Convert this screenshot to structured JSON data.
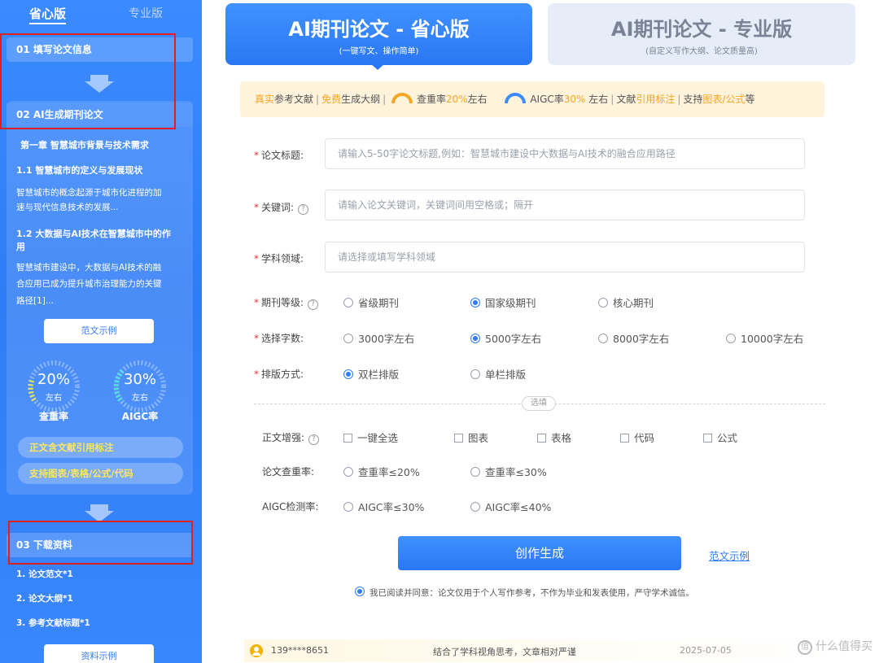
{
  "sidebar": {
    "tabs": [
      "省心版",
      "专业版"
    ],
    "step1": "01 填写论文信息",
    "step2": "02 AI生成期刊论文",
    "chapter": "第一章 智慧城市背景与技术需求",
    "sec1_title": "1.1 智慧城市的定义与发展现状",
    "sec1_body_1": "智慧城市的概念起源于城市化进程的加",
    "sec1_body_2": "速与现代信息技术的发展...",
    "sec2_title_1": "1.2 大数据与AI技术在智慧城市中的作",
    "sec2_title_2": "用",
    "sec2_body_1": "智慧城市建设中，大数据与AI技术的融",
    "sec2_body_2": "合应用已成为提升城市治理能力的关键",
    "sec2_body_3": "路径[1]...",
    "sample_btn": "范文示例",
    "gauge1_value": "20%",
    "gauge1_sub": "左右",
    "gauge1_label": "查重率",
    "gauge2_value": "30%",
    "gauge2_sub": "左右",
    "gauge2_label": "AIGC率",
    "pill1": "正文含文献引用标注",
    "pill2": "支持图表/表格/公式/代码",
    "step3": "03 下载资料",
    "downloads": [
      "1. 论文范文*1",
      "2. 论文大纲*1",
      "3. 参考文献标题*1"
    ],
    "download_sample_btn": "资料示例"
  },
  "modes": {
    "active_title": "AI期刊论文 - 省心版",
    "active_sub": "(一键写文、操作简单)",
    "inactive_title": "AI期刊论文 - 专业版",
    "inactive_sub": "(自定义写作大纲、论文质量高)"
  },
  "features": {
    "f1a": "真实",
    "f1b": "参考文献",
    "f2a": "免费",
    "f2b": "生成大纲",
    "f3a": "查重率",
    "f3b": "20%",
    "f3c": "左右",
    "f4a": "AIGC率",
    "f4b": "30%",
    "f4c": " 左右",
    "f5a": "文献",
    "f5b": "引用标注",
    "f6a": "支持",
    "f6b": "图表/公式",
    "f6c": "等",
    "sep": "|"
  },
  "form": {
    "title_label": "论文标题:",
    "title_placeholder": "请输入5-50字论文标题,例如：智慧城市建设中大数据与AI技术的融合应用路径",
    "keywords_label": "关键词:",
    "keywords_placeholder": "请输入论文关键词，关键词间用空格或；隔开",
    "field_label": "学科领域:",
    "field_placeholder": "请选择或填写学科领域",
    "level_label": "期刊等级:",
    "level_options": [
      "省级期刊",
      "国家级期刊",
      "核心期刊"
    ],
    "words_label": "选择字数:",
    "words_options": [
      "3000字左右",
      "5000字左右",
      "8000字左右",
      "10000字左右"
    ],
    "layout_label": "排版方式:",
    "layout_options": [
      "双栏排版",
      "单栏排版"
    ],
    "optional_label": "选填",
    "enhance_label": "正文增强:",
    "enhance_options": [
      "一键全选",
      "图表",
      "表格",
      "代码",
      "公式"
    ],
    "dup_label": "论文查重率:",
    "dup_options": [
      "查重率≤20%",
      "查重率≤30%"
    ],
    "aigc_label": "AIGC检测率:",
    "aigc_options": [
      "AIGC率≤30%",
      "AIGC率≤40%"
    ],
    "required_mark": "*"
  },
  "actions": {
    "submit": "创作生成",
    "sample_link": "范文示例",
    "agreement": "我已阅读并同意：论文仅用于个人写作参考，不作为毕业和发表使用，严守学术诚信。"
  },
  "ticker": {
    "phone": "139****8651",
    "comment": "结合了学科视角思考，文章相对严谨",
    "date": "2025-07-05"
  },
  "watermark": {
    "logo": "值",
    "text": "什么值得买"
  },
  "colors": {
    "brand_blue": "#2f7cf6",
    "accent_orange": "#f5a623",
    "highlight_red": "#e0201e"
  }
}
